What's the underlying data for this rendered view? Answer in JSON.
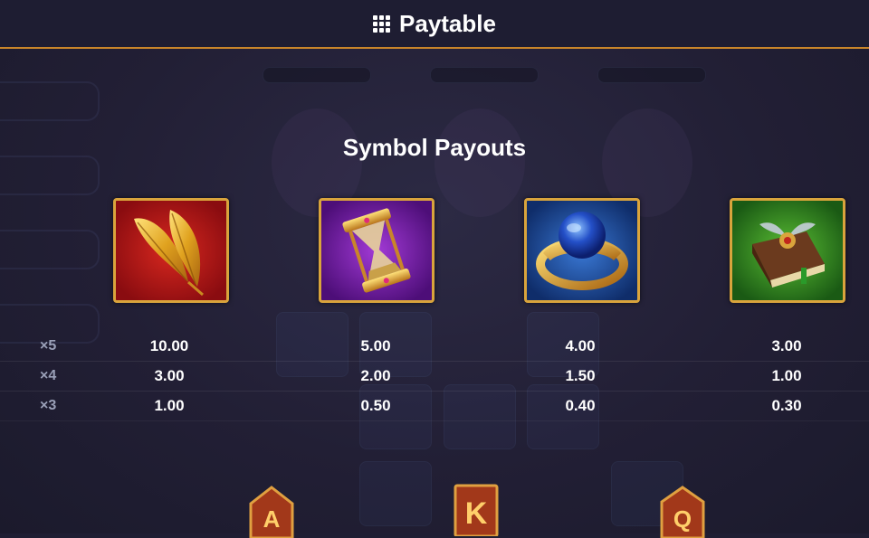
{
  "header": {
    "title": "Paytable",
    "icon": "grid-icon"
  },
  "section": {
    "title": "Symbol Payouts"
  },
  "symbols": [
    {
      "name": "golden-feathers",
      "icon": "feathers-icon",
      "bg": "#b3141b"
    },
    {
      "name": "hourglass",
      "icon": "hourglass-icon",
      "bg": "#7a1fae"
    },
    {
      "name": "blue-gem-ring",
      "icon": "ring-icon",
      "bg": "#1d4fa8"
    },
    {
      "name": "winged-book",
      "icon": "book-icon",
      "bg": "#2e8b23"
    }
  ],
  "payouts": [
    {
      "multiplier": "×5",
      "values": [
        "10.00",
        "5.00",
        "4.00",
        "3.00"
      ]
    },
    {
      "multiplier": "×4",
      "values": [
        "3.00",
        "2.00",
        "1.50",
        "1.00"
      ]
    },
    {
      "multiplier": "×3",
      "values": [
        "1.00",
        "0.50",
        "0.40",
        "0.30"
      ]
    }
  ],
  "bottom_symbols": [
    "A",
    "K",
    "Q"
  ],
  "colors": {
    "accent": "#c9852a",
    "frame": "#d9a43c",
    "header_bg": "#1e1d32",
    "page_bg": "#1f1e33"
  }
}
